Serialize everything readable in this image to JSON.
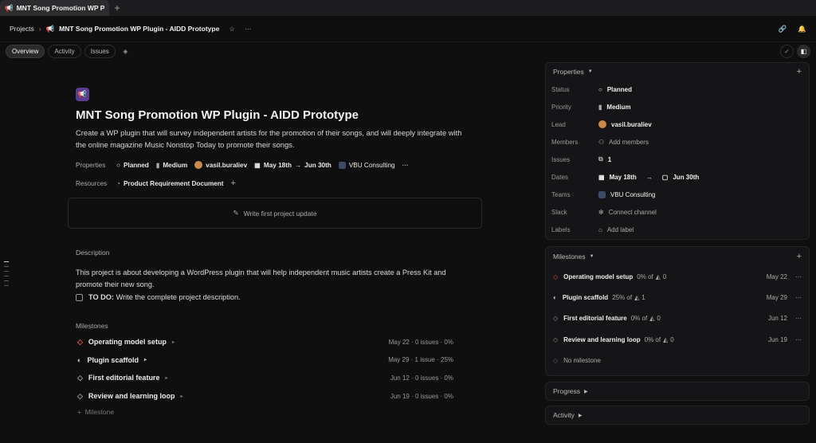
{
  "browser": {
    "tab_title": "MNT Song Promotion WP Plugin",
    "new_tab": "+"
  },
  "header": {
    "breadcrumb_root": "Projects",
    "project_name": "MNT Song Promotion WP Plugin - AIDD Prototype"
  },
  "tabs": [
    {
      "label": "Overview"
    },
    {
      "label": "Activity"
    },
    {
      "label": "Issues"
    }
  ],
  "project": {
    "title": "MNT Song Promotion WP Plugin - AIDD Prototype",
    "summary": "Create a WP plugin that will survey independent artists for the promotion of their songs, and will deeply integrate with the online magazine Music Nonstop Today to promote their songs.",
    "properties_label": "Properties",
    "status": "Planned",
    "priority": "Medium",
    "lead": "vasil.buraliev",
    "start": "May 18th",
    "target": "Jun 30th",
    "team": "VBU Consulting",
    "resources_label": "Resources",
    "resource": "Product Requirement Document",
    "update_cta": "Write first project update",
    "description_label": "Description",
    "description": "This project is about developing a WordPress plugin that will help independent music artists create a Press Kit and promote their new song.",
    "todo_bold": "TO DO:",
    "todo_text": "Write the complete project description.",
    "milestones_label": "Milestones",
    "add_milestone": "Milestone"
  },
  "milestones": [
    {
      "name": "Operating model setup",
      "meta": "May 22 · 0 issues · 0%",
      "pct": "0% of",
      "count": "0",
      "date": "May 22",
      "color": "#e0534a"
    },
    {
      "name": "Plugin scaffold",
      "meta": "May 29 · 1 issue · 25%",
      "pct": "25% of",
      "count": "1",
      "date": "May 29",
      "color": "#cccccc"
    },
    {
      "name": "First editorial feature",
      "meta": "Jun 12 · 0 issues · 0%",
      "pct": "0% of",
      "count": "0",
      "date": "Jun 12",
      "color": "#999999"
    },
    {
      "name": "Review and learning loop",
      "meta": "Jun 19 · 0 issues · 0%",
      "pct": "0% of",
      "count": "0",
      "date": "Jun 19",
      "color": "#999999"
    }
  ],
  "sidebar": {
    "properties_title": "Properties",
    "rows": {
      "status_k": "Status",
      "status_v": "Planned",
      "priority_k": "Priority",
      "priority_v": "Medium",
      "lead_k": "Lead",
      "lead_v": "vasil.buraliev",
      "members_k": "Members",
      "members_v": "Add members",
      "issues_k": "Issues",
      "issues_v": "1",
      "dates_k": "Dates",
      "start_v": "May 18th",
      "end_v": "Jun 30th",
      "teams_k": "Teams",
      "teams_v": "VBU Consulting",
      "slack_k": "Slack",
      "slack_v": "Connect channel",
      "labels_k": "Labels",
      "labels_v": "Add label"
    },
    "milestones_title": "Milestones",
    "no_milestone": "No milestone",
    "progress_title": "Progress",
    "activity_title": "Activity"
  },
  "colors": {
    "accent": "#5b3c8f",
    "bg": "#0f0f10",
    "panel": "#151517"
  }
}
